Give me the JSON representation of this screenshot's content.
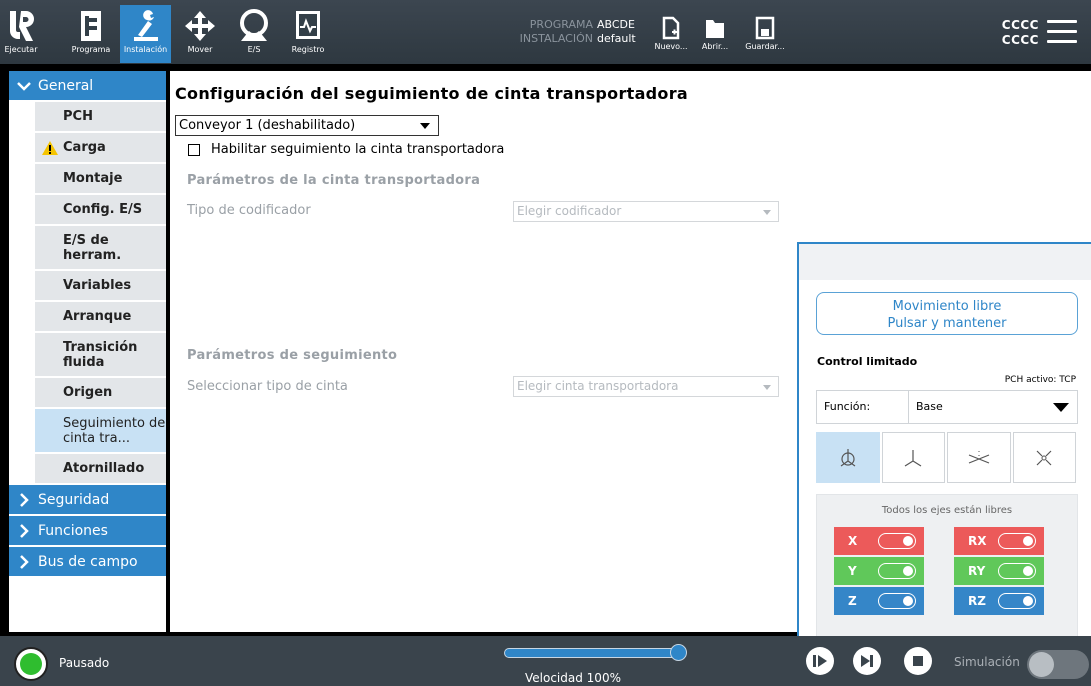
{
  "topbar": {
    "tabs": [
      {
        "label": "Ejecutar",
        "icon": "ur-logo-icon"
      },
      {
        "label": "Programa",
        "icon": "program-icon"
      },
      {
        "label": "Instalación",
        "icon": "installation-icon",
        "active": true
      },
      {
        "label": "Mover",
        "icon": "move-icon"
      },
      {
        "label": "E/S",
        "icon": "io-icon"
      },
      {
        "label": "Registro",
        "icon": "log-icon"
      }
    ],
    "program_label": "PROGRAMA",
    "program_value": "ABCDE",
    "installation_label": "INSTALACIÓN",
    "installation_value": "default",
    "file_buttons": [
      {
        "label": "Nuevo...",
        "icon": "new-file-icon"
      },
      {
        "label": "Abrir...",
        "icon": "open-folder-icon"
      },
      {
        "label": "Guardar...",
        "icon": "save-icon"
      }
    ],
    "user_line1": "CCCC",
    "user_line2": "CCCC",
    "accent": "#2f86c8"
  },
  "sidebar": {
    "general": "General",
    "items": [
      {
        "label": "PCH"
      },
      {
        "label": "Carga",
        "warning": true
      },
      {
        "label": "Montaje"
      },
      {
        "label": "Config. E/S"
      },
      {
        "label": "E/S de herram."
      },
      {
        "label": "Variables"
      },
      {
        "label": "Arranque"
      },
      {
        "label": "Transición fluida"
      },
      {
        "label": "Origen"
      },
      {
        "label": "Seguimiento de cinta tra...",
        "selected": true
      },
      {
        "label": "Atornillado"
      }
    ],
    "sections": [
      "Seguridad",
      "Funciones",
      "Bus de campo"
    ]
  },
  "main": {
    "title": "Configuración del seguimiento de cinta transportadora",
    "conveyor_select": "Conveyor 1 (deshabilitado)",
    "enable_checkbox": "Habilitar seguimiento la cinta transportadora",
    "conveyor_params_heading": "Parámetros de la cinta transportadora",
    "encoder_type_label": "Tipo de codificador",
    "encoder_placeholder": "Elegir codificador",
    "tracking_params_heading": "Parámetros de seguimiento",
    "belt_type_label": "Seleccionar tipo de cinta",
    "belt_placeholder": "Elegir cinta transportadora"
  },
  "freedrive": {
    "button_title": "Movimiento libre",
    "button_sub": "Pulsar y mantener",
    "control_label": "Control limitado",
    "pch_active": "PCH activo: TCP",
    "function_label": "Función:",
    "function_value": "Base",
    "frames": [
      "base-frame-icon",
      "tool-frame-icon",
      "plane-frame-icon",
      "free-frame-icon"
    ],
    "axes_caption": "Todos los ejes están libres",
    "axes": [
      {
        "name": "X",
        "color": "#ec5a5a",
        "on": true
      },
      {
        "name": "RX",
        "color": "#ec5a5a",
        "on": true
      },
      {
        "name": "Y",
        "color": "#60c85a",
        "on": true
      },
      {
        "name": "RY",
        "color": "#60c85a",
        "on": true
      },
      {
        "name": "Z",
        "color": "#3586c8",
        "on": true
      },
      {
        "name": "RZ",
        "color": "#3586c8",
        "on": true
      }
    ]
  },
  "bottombar": {
    "status": "Pausado",
    "speed_label": "Velocidad 100%",
    "speed_percent": 100,
    "simulation_label": "Simulación",
    "simulation_on": false
  }
}
